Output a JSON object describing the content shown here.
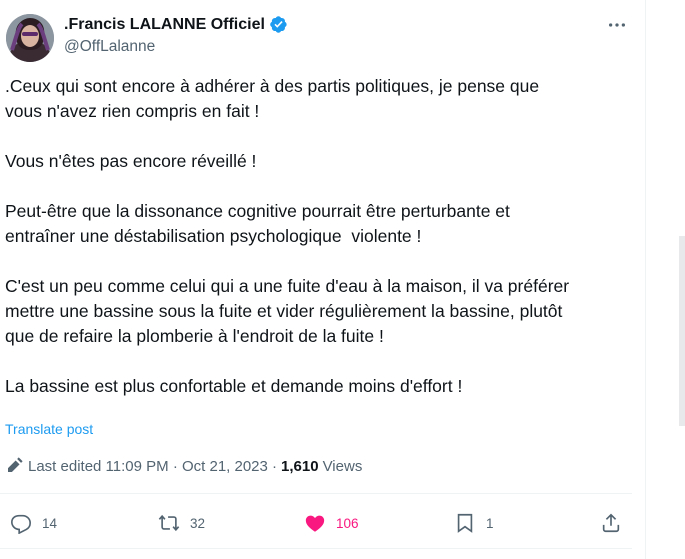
{
  "author": {
    "display_name": ".Francis LALANNE Officiel",
    "handle": "@OffLalanne"
  },
  "tweet": {
    "paragraphs": [
      ".Ceux qui sont encore à adhérer à des partis politiques, je pense que\nvous n'avez rien compris en fait !",
      "Vous n'êtes pas encore réveillé !",
      "Peut-être que la dissonance cognitive pourrait être perturbante et\nentraîner une déstabilisation psychologique  violente !",
      "C'est un peu comme celui qui a une fuite d'eau à la maison, il va préférer\nmettre une bassine sous la fuite et vider régulièrement la bassine, plutôt\nque de refaire la plomberie à l'endroit de la fuite !",
      "La bassine est plus confortable et demande moins d'effort !"
    ],
    "translate_label": "Translate post"
  },
  "meta": {
    "edited": "Last edited 11:09 PM · Oct 21, 2023 · ",
    "views_count": "1,610",
    "views_label": "Views"
  },
  "actions": {
    "replies": "14",
    "reposts": "32",
    "likes": "106",
    "bookmarks": "1"
  },
  "colors": {
    "accent": "#1d9bf0",
    "like": "#f91880",
    "muted": "#536471",
    "text": "#0f1419"
  },
  "icons": {
    "verified": "verified-badge-icon",
    "more": "more-icon",
    "pencil": "pencil-icon",
    "reply": "reply-icon",
    "repost": "repost-icon",
    "like": "heart-icon",
    "bookmark": "bookmark-icon",
    "share": "share-icon"
  }
}
